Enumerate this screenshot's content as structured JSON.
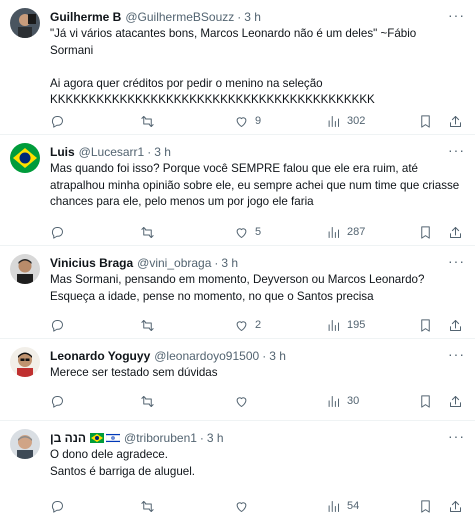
{
  "tweets": [
    {
      "name": "Guilherme B",
      "handle": "@GuilhermeBSouzz",
      "time": "3 h",
      "text": "\"Já vi vários atacantes bons, Marcos Leonardo não é um deles\" ~Fábio Sormani\n\nAi agora quer créditos por pedir o menino na seleção\nKKKKKKKKKKKKKKKKKKKKKKKKKKKKKKKKKKKKKKKKKK",
      "replies": "",
      "retweets": "",
      "likes": "9",
      "views": "302"
    },
    {
      "name": "Luis",
      "handle": "@Lucesarr1",
      "time": "3 h",
      "text": "Mas quando foi isso? Porque você SEMPRE falou que ele era ruim, até atrapalhou minha opinião sobre ele, eu sempre achei que num time que criasse chances para ele, pelo menos um por jogo ele faria",
      "replies": "",
      "retweets": "",
      "likes": "5",
      "views": "287"
    },
    {
      "name": "Vinicius Braga",
      "handle": "@vini_obraga",
      "time": "3 h",
      "text": "Mas Sormani, pensando em momento, Deyverson ou Marcos Leonardo?\nEsqueça a idade, pense no momento, no que o Santos precisa",
      "replies": "",
      "retweets": "",
      "likes": "2",
      "views": "195"
    },
    {
      "name": "Leonardo Yoguyy",
      "handle": "@leonardoyo91500",
      "time": "3 h",
      "text": "Merece ser testado sem dúvidas",
      "replies": "",
      "retweets": "",
      "likes": "",
      "views": "30"
    },
    {
      "name": "הנה בן",
      "handle": "@triboruben1",
      "time": "3 h",
      "text": "O dono dele agradece.\nSantos é barriga de aluguel.",
      "replies": "",
      "retweets": "",
      "likes": "",
      "views": "54"
    }
  ],
  "icons": {
    "reply": "reply-icon",
    "retweet": "retweet-icon",
    "like": "heart-icon",
    "views": "views-chart-icon",
    "bookmark": "bookmark-icon",
    "share": "share-icon",
    "more": "more-icon"
  },
  "colors": {
    "text": "#0f1419",
    "secondary": "#536471",
    "divider": "#eff3f4",
    "brazil_green": "#009c3b",
    "brazil_yellow": "#ffdf00",
    "israel_blue": "#0038b8"
  }
}
